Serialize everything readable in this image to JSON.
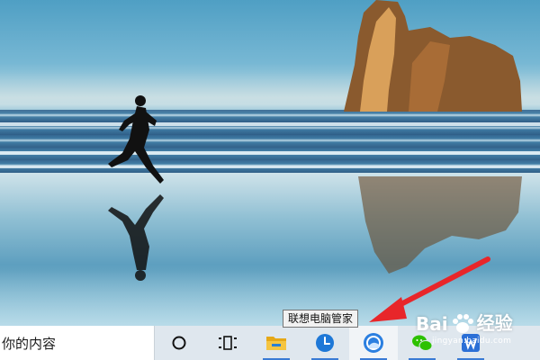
{
  "taskbar": {
    "search_text": "你的内容",
    "tooltip": "联想电脑管家",
    "icons": [
      "cortana-circle-icon",
      "task-view-icon",
      "file-explorer-icon",
      "clock-app-icon",
      "lenovo-pc-manager-icon",
      "wechat-icon",
      "other-app-icon"
    ]
  },
  "watermark": {
    "brand": "Bai",
    "brand_cn": "经验",
    "url": "jingyan.baidu.com"
  },
  "colors": {
    "taskbar_bg": "#dfe7ee",
    "accent": "#3a7bd5",
    "arrow": "#e8262a"
  }
}
